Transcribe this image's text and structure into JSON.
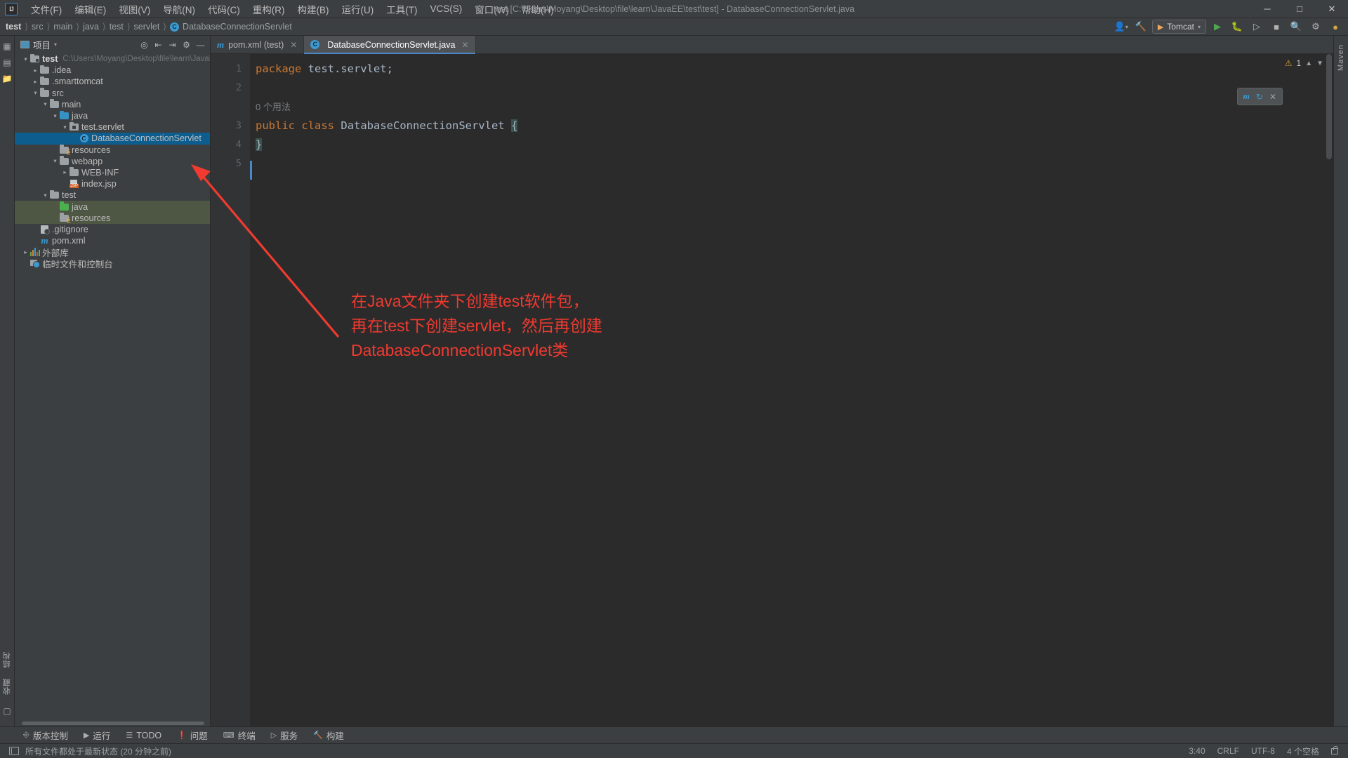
{
  "window": {
    "title": "test [C:\\Users\\Moyang\\Desktop\\file\\learn\\JavaEE\\test\\test] - DatabaseConnectionServlet.java",
    "logo": "IJ",
    "minimize": "─",
    "maximize": "□",
    "close": "✕"
  },
  "menu": {
    "items": [
      {
        "label": "文件(F)",
        "name": "menu-file"
      },
      {
        "label": "编辑(E)",
        "name": "menu-edit"
      },
      {
        "label": "视图(V)",
        "name": "menu-view"
      },
      {
        "label": "导航(N)",
        "name": "menu-navigate"
      },
      {
        "label": "代码(C)",
        "name": "menu-code"
      },
      {
        "label": "重构(R)",
        "name": "menu-refactor"
      },
      {
        "label": "构建(B)",
        "name": "menu-build"
      },
      {
        "label": "运行(U)",
        "name": "menu-run"
      },
      {
        "label": "工具(T)",
        "name": "menu-tools"
      },
      {
        "label": "VCS(S)",
        "name": "menu-vcs"
      },
      {
        "label": "窗口(W)",
        "name": "menu-window"
      },
      {
        "label": "帮助(H)",
        "name": "menu-help"
      }
    ]
  },
  "breadcrumb": {
    "items": [
      "test",
      "src",
      "main",
      "java",
      "test",
      "servlet"
    ],
    "leaf": "DatabaseConnectionServlet",
    "leaf_badge": "C"
  },
  "navbar_right": {
    "run_config": "Tomcat",
    "icons": [
      "user-icon",
      "hammer-icon",
      "run-icon",
      "debug-icon",
      "run-with-coverage-icon",
      "stop-icon",
      "search-icon",
      "settings-icon",
      "account-icon"
    ]
  },
  "project_panel": {
    "title": "项目",
    "header_icons": [
      "locate-icon",
      "expand-all-icon",
      "collapse-all-icon",
      "settings-icon",
      "hide-icon"
    ],
    "tree": [
      {
        "label": "test",
        "path": "C:\\Users\\Moyang\\Desktop\\file\\learn\\JavaEE\\te",
        "indent": 0,
        "twist": "v",
        "icon": "module-folder",
        "bold": true
      },
      {
        "label": ".idea",
        "indent": 1,
        "twist": ">",
        "icon": "folder-grey"
      },
      {
        "label": ".smarttomcat",
        "indent": 1,
        "twist": ">",
        "icon": "folder-grey"
      },
      {
        "label": "src",
        "indent": 1,
        "twist": "v",
        "icon": "folder-grey"
      },
      {
        "label": "main",
        "indent": 2,
        "twist": "v",
        "icon": "folder-grey"
      },
      {
        "label": "java",
        "indent": 3,
        "twist": "v",
        "icon": "folder-blue"
      },
      {
        "label": "test.servlet",
        "indent": 4,
        "twist": "v",
        "icon": "package"
      },
      {
        "label": "DatabaseConnectionServlet",
        "indent": 5,
        "twist": "",
        "icon": "class",
        "selected": true
      },
      {
        "label": "resources",
        "indent": 3,
        "twist": "",
        "icon": "folder-resources"
      },
      {
        "label": "webapp",
        "indent": 3,
        "twist": "v",
        "icon": "folder-grey"
      },
      {
        "label": "WEB-INF",
        "indent": 4,
        "twist": ">",
        "icon": "folder-grey"
      },
      {
        "label": "index.jsp",
        "indent": 4,
        "twist": "",
        "icon": "jsp"
      },
      {
        "label": "test",
        "indent": 2,
        "twist": "v",
        "icon": "folder-grey"
      },
      {
        "label": "java",
        "indent": 3,
        "twist": "",
        "icon": "folder-green",
        "testsrc": true
      },
      {
        "label": "resources",
        "indent": 3,
        "twist": "",
        "icon": "folder-test-resources",
        "testsrc": true
      },
      {
        "label": ".gitignore",
        "indent": 1,
        "twist": "",
        "icon": "gitignore"
      },
      {
        "label": "pom.xml",
        "indent": 1,
        "twist": "",
        "icon": "maven"
      },
      {
        "label": "外部库",
        "indent": 0,
        "twist": ">",
        "icon": "library"
      },
      {
        "label": "临时文件和控制台",
        "indent": 0,
        "twist": "",
        "icon": "scratches"
      }
    ]
  },
  "left_strip": {
    "top_icons": [
      "project-icon",
      "structure-icon",
      "bookmarks-icon"
    ],
    "bottom_labels": [
      "结构",
      "收藏"
    ]
  },
  "right_strip": {
    "labels": [
      "Maven"
    ]
  },
  "editor": {
    "tabs": [
      {
        "label": "pom.xml (test)",
        "icon": "maven-icon",
        "active": false
      },
      {
        "label": "DatabaseConnectionServlet.java",
        "icon": "class-icon",
        "active": true
      }
    ],
    "line_numbers": [
      "1",
      "2",
      "3",
      "4",
      "5"
    ],
    "usages_hint": "0 个用法",
    "code": {
      "l1_kw": "package",
      "l1_rest": " test.servlet;",
      "l3_kw1": "public",
      "l3_kw2": "class",
      "l3_name": "DatabaseConnectionServlet",
      "l3_brace": "{",
      "l4": "}"
    },
    "inspection": {
      "warning_count": "1",
      "warning_glyph": "⚠"
    },
    "float_widget": {
      "icon": "maven-icon",
      "label": "m",
      "close": "✕"
    }
  },
  "annotation": {
    "lines": [
      "在Java文件夹下创建test软件包，",
      "再在test下创建servlet，然后再创建",
      "DatabaseConnectionServlet类"
    ],
    "color": "#f13a30"
  },
  "bottom_toolwindows": [
    {
      "label": "版本控制",
      "icon": "vcs-icon"
    },
    {
      "label": "运行",
      "icon": "run-icon"
    },
    {
      "label": "TODO",
      "icon": "todo-icon"
    },
    {
      "label": "问题",
      "icon": "problems-icon"
    },
    {
      "label": "终端",
      "icon": "terminal-icon"
    },
    {
      "label": "服务",
      "icon": "services-icon"
    },
    {
      "label": "构建",
      "icon": "build-icon"
    }
  ],
  "statusbar": {
    "message": "所有文件都处于最新状态 (20 分钟之前)",
    "position": "3:40",
    "line_sep": "CRLF",
    "encoding": "UTF-8",
    "indent": "4 个空格",
    "lock": "lock-icon"
  }
}
